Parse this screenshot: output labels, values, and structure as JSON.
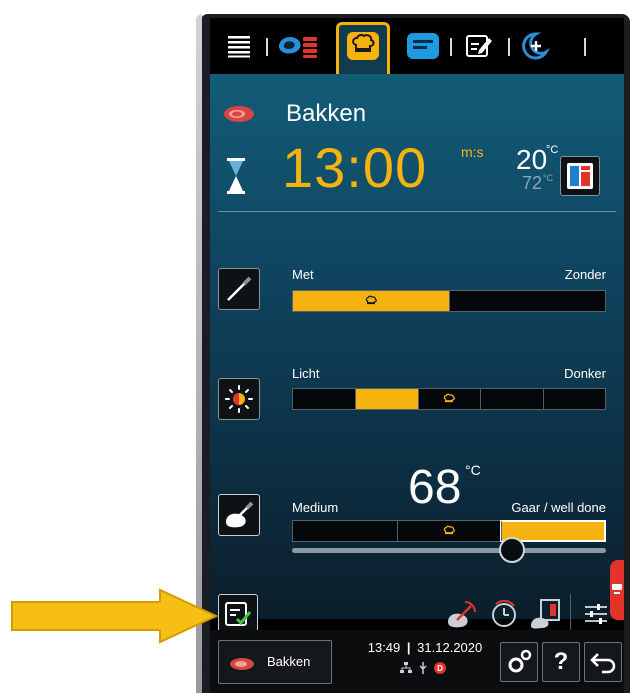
{
  "program": {
    "title": "Bakken",
    "time": "13:00",
    "time_unit": "m:s",
    "temp_main": "20",
    "temp_main_unit": "°C",
    "temp_sub": "72",
    "temp_sub_unit": "°C"
  },
  "top_tabs": [
    {
      "name": "menu",
      "icon": "menu-icon"
    },
    {
      "name": "cooking-paths",
      "icon": "meat-layers-icon"
    },
    {
      "name": "chef-hat",
      "icon": "chef-hat-icon",
      "active": true
    },
    {
      "name": "list",
      "icon": "list-card-icon"
    },
    {
      "name": "notes",
      "icon": "edit-notes-icon"
    },
    {
      "name": "special",
      "icon": "moon-plus-icon"
    }
  ],
  "settings": [
    {
      "name": "crust",
      "left_label": "Met",
      "right_label": "Zonder",
      "segments": 2,
      "selected_segment": 1,
      "recommended_segment": 1
    },
    {
      "name": "browning",
      "left_label": "Licht",
      "right_label": "Donker",
      "segments": 5,
      "selected_segment": 2,
      "recommended_segment": 3
    },
    {
      "name": "core-temperature",
      "left_label": "Medium",
      "right_label": "Gaar / well done",
      "value": "68",
      "unit": "°C",
      "segments": 3,
      "selected_segment": 3,
      "recommended_segment": 2,
      "slider_level": 0.7
    }
  ],
  "status_bar": {
    "program_label": "Bakken",
    "time": "13:49",
    "date": "31.12.2020",
    "help_label": "?"
  },
  "colors": {
    "accent": "#f6b30f",
    "panel_top": "#125c78",
    "panel_bottom": "#0b1e2b",
    "alert": "#e3342b"
  }
}
